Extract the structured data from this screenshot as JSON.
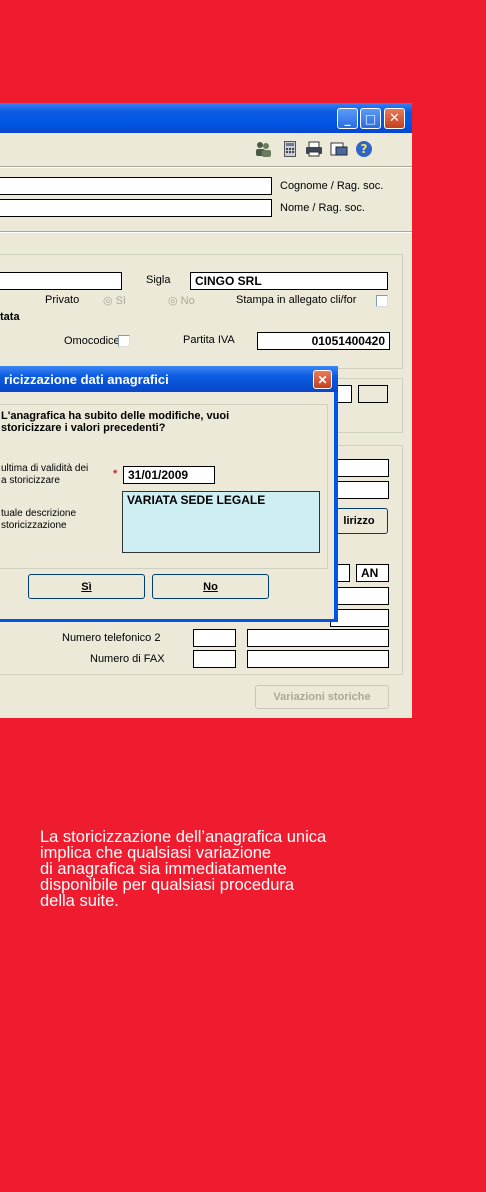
{
  "window": {
    "toolbar_icons": [
      "people-icon",
      "calculator-icon",
      "printer-icon",
      "print-preview-icon",
      "help-icon"
    ],
    "cognome_label": "Cognome / Rag. soc.",
    "nome_label": "Nome / Rag. soc.",
    "sigla_label": "Sigla",
    "sigla_value": "CINGO SRL",
    "privato_label": "Privato",
    "si_radio": "Sì",
    "no_radio": "No",
    "stampa_label": "Stampa in allegato cli/for",
    "section_label": "tata",
    "omocodice_label": "Omocodice",
    "partita_iva_label": "Partita IVA",
    "partita_iva_value": "01051400420",
    "indirizzo_button": "lirizzo",
    "provincia_value": "AN",
    "tel2_label": "Numero telefonico 2",
    "fax_label": "Numero di FAX",
    "variazioni_button": "Variazioni storiche"
  },
  "dialog": {
    "title": "ricizzazione dati anagrafici",
    "question_line1": "L'anagrafica ha subito delle modifiche, vuoi",
    "question_line2": "storicizzare i valori  precedenti?",
    "date_label_line1": "ultima di validità dei",
    "date_label_line2": "a storicizzare",
    "required_mark": "*",
    "date_value": "31/01/2009",
    "desc_label_line1": "tuale descrizione",
    "desc_label_line2": "storicizzazione",
    "desc_value": "VARIATA SEDE LEGALE",
    "yes_button": "Sì",
    "no_button": "No"
  },
  "caption": {
    "line1": "La storicizzazione dell’anagrafica unica",
    "line2": "implica che qualsiasi variazione",
    "line3": "di anagrafica sia immediatamente",
    "line4": "disponibile per qualsiasi procedura",
    "line5": "della suite."
  },
  "colors": {
    "background": "#EE1C2E",
    "window_face": "#ECE9D8",
    "titlebar_blue": "#0055E5",
    "description_field": "#CDEEF2"
  }
}
